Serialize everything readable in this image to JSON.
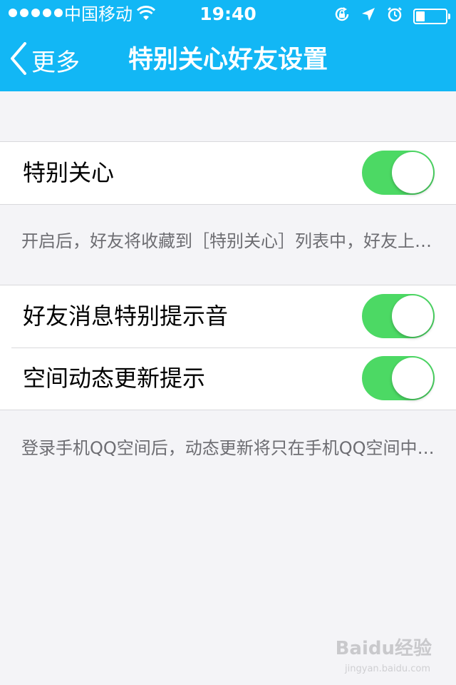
{
  "status_bar": {
    "carrier": "中国移动",
    "time": "19:40"
  },
  "nav": {
    "back_label": "更多",
    "title": "特别关心好友设置"
  },
  "section1": {
    "rows": [
      {
        "label": "特别关心",
        "toggle_on": true
      }
    ],
    "footnote": "开启后，好友将收藏到［特别关心］列表中，好友上线时你将收到提醒"
  },
  "section2": {
    "rows": [
      {
        "label": "好友消息特别提示音",
        "toggle_on": true
      },
      {
        "label": "空间动态更新提示",
        "toggle_on": true
      }
    ],
    "footnote": "登录手机QQ空间后，动态更新将只在手机QQ空间中提示"
  },
  "watermark": {
    "brand": "Baidu经验",
    "url": "jingyan.baidu.com"
  },
  "colors": {
    "header": "#12b7f5",
    "toggle_on": "#4cd964",
    "background": "#f4f4f7"
  },
  "icons": [
    "back-chevron-icon",
    "wifi-icon",
    "orientation-lock-icon",
    "location-arrow-icon",
    "alarm-icon",
    "battery-icon"
  ]
}
